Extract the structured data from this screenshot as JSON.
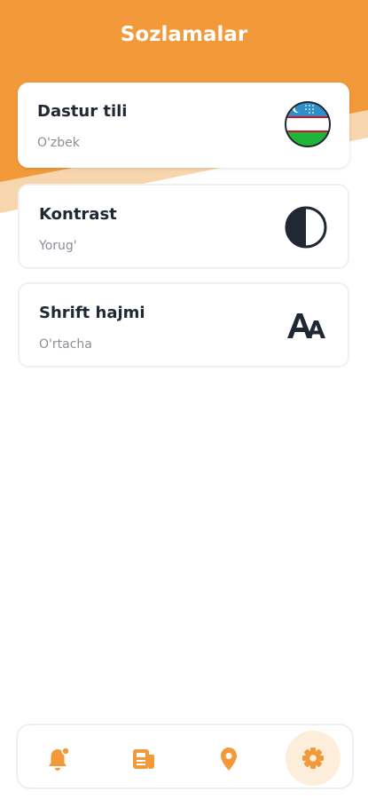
{
  "colors": {
    "accent": "#f29a3a",
    "accent_light": "#f7d6ad",
    "text_dark": "#1f2833",
    "text_muted": "#8a8f96",
    "active_tab_bg": "#fdeedc"
  },
  "header": {
    "title": "Sozlamalar"
  },
  "settings": [
    {
      "title": "Dastur tili",
      "subtitle": "O'zbek",
      "icon": "uzbekistan-flag-icon"
    },
    {
      "title": "Kontrast",
      "subtitle": "Yorug'",
      "icon": "contrast-icon"
    },
    {
      "title": "Shrift hajmi",
      "subtitle": "O'rtacha",
      "icon": "font-size-icon"
    }
  ],
  "nav": {
    "items": [
      {
        "icon": "notifications-bell-icon",
        "active": false
      },
      {
        "icon": "news-icon",
        "active": false
      },
      {
        "icon": "location-pin-icon",
        "active": false
      },
      {
        "icon": "settings-gear-icon",
        "active": true
      }
    ]
  }
}
